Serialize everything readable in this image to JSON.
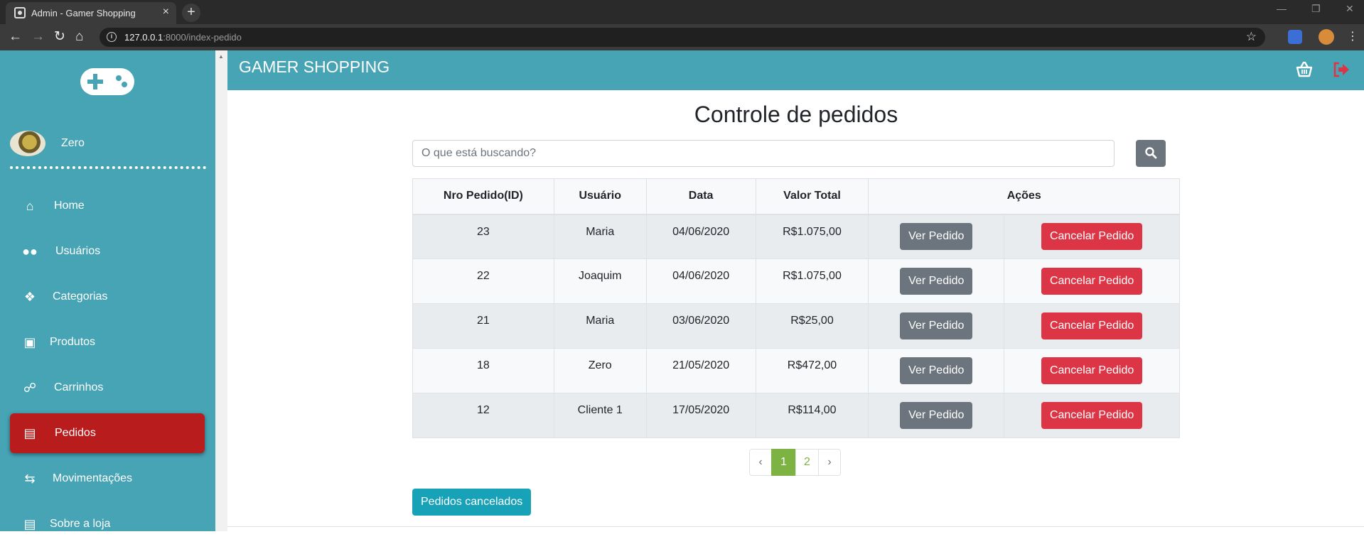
{
  "browser": {
    "tab_title": "Admin - Gamer Shopping",
    "tab_close": "×",
    "new_tab": "+",
    "url_host": "127.0.0.1",
    "url_rest": ":8000/index-pedido",
    "window_controls": [
      "—",
      "❐",
      "✕"
    ]
  },
  "sidebar": {
    "username": "Zero",
    "items": [
      {
        "label": "Home",
        "icon": "home-icon"
      },
      {
        "label": "Usuários",
        "icon": "users-icon"
      },
      {
        "label": "Categorias",
        "icon": "cubes-icon"
      },
      {
        "label": "Produtos",
        "icon": "shopping-bag-icon"
      },
      {
        "label": "Carrinhos",
        "icon": "cart-icon"
      },
      {
        "label": "Pedidos",
        "icon": "truck-icon",
        "active": true
      },
      {
        "label": "Movimentações",
        "icon": "exchange-icon"
      },
      {
        "label": "Sobre a loja",
        "icon": "document-icon"
      }
    ]
  },
  "header": {
    "brand": "GAMER SHOPPING"
  },
  "main": {
    "title": "Controle de pedidos",
    "search_placeholder": "O que está buscando?",
    "table": {
      "headers": [
        "Nro Pedido(ID)",
        "Usuário",
        "Data",
        "Valor Total",
        "Ações"
      ],
      "rows": [
        {
          "id": "23",
          "user": "Maria",
          "date": "04/06/2020",
          "total": "R$1.075,00"
        },
        {
          "id": "22",
          "user": "Joaquim",
          "date": "04/06/2020",
          "total": "R$1.075,00"
        },
        {
          "id": "21",
          "user": "Maria",
          "date": "03/06/2020",
          "total": "R$25,00"
        },
        {
          "id": "18",
          "user": "Zero",
          "date": "21/05/2020",
          "total": "R$472,00"
        },
        {
          "id": "12",
          "user": "Cliente 1",
          "date": "17/05/2020",
          "total": "R$114,00"
        }
      ],
      "view_label": "Ver Pedido",
      "cancel_label": "Cancelar Pedido"
    },
    "pagination": {
      "prev": "‹",
      "pages": [
        "1",
        "2"
      ],
      "current": "1",
      "next": "›"
    },
    "cancelled_button": "Pedidos cancelados"
  },
  "colors": {
    "sidebar": "#47a4b5",
    "active_item": "#b91c1c",
    "danger": "#dc3545",
    "secondary": "#6c757d",
    "info": "#17a2b8",
    "page_active": "#7cb342"
  }
}
